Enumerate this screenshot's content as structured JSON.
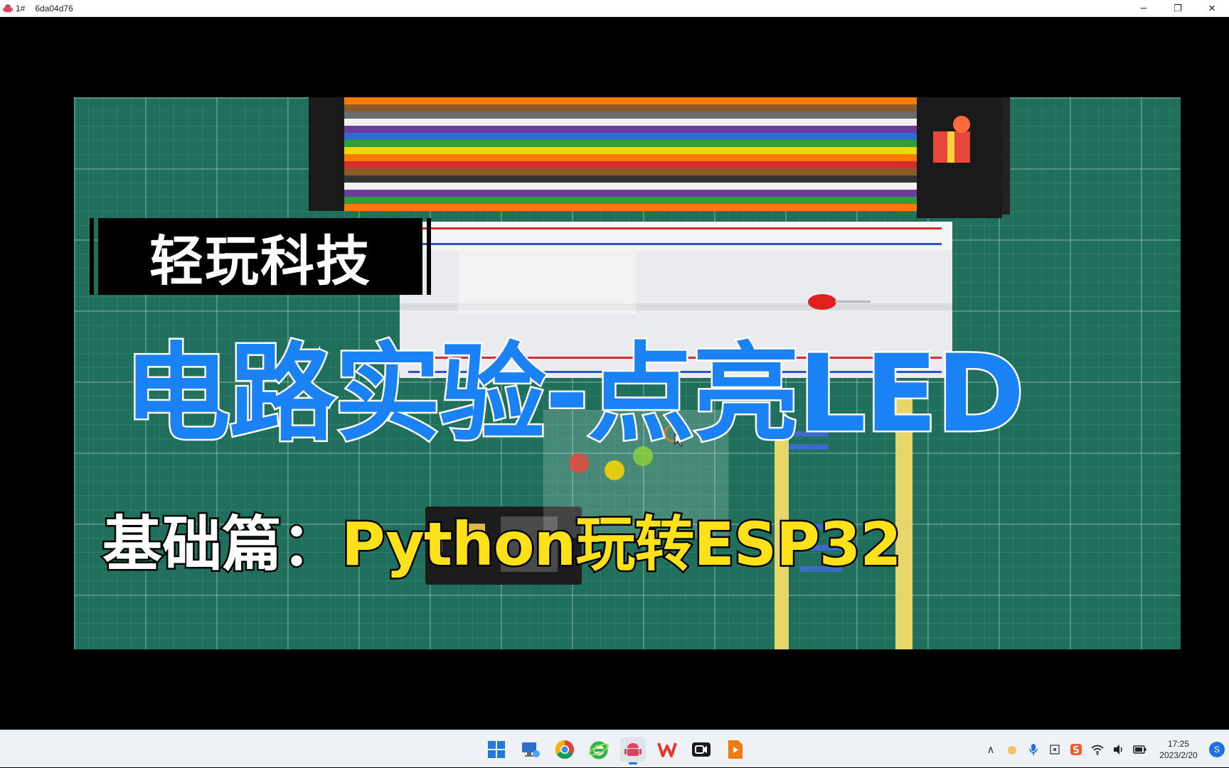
{
  "window": {
    "index_label": "1#",
    "title": "6da04d76",
    "minimize": "─",
    "restore": "❐",
    "close": "✕"
  },
  "video": {
    "badge_text": "轻玩科技",
    "headline": "电路实验-点亮LED",
    "subline_prefix": "基础篇：",
    "subline_main": "Python玩转ESP32"
  },
  "taskbar": {
    "pinned": [
      {
        "name": "start-icon"
      },
      {
        "name": "remote-desktop-icon"
      },
      {
        "name": "chrome-icon"
      },
      {
        "name": "ie-icon"
      },
      {
        "name": "android-icon",
        "active": true
      },
      {
        "name": "wps-icon"
      },
      {
        "name": "video-recorder-icon"
      },
      {
        "name": "player-icon"
      }
    ],
    "tray": {
      "chevron": "∧",
      "clock_time": "17:25",
      "clock_date": "2023/2/20",
      "notification": "S"
    }
  },
  "colors": {
    "headline": "#1b82f5",
    "subline_main": "#ffe11a",
    "mat": "#1f6f5c"
  }
}
